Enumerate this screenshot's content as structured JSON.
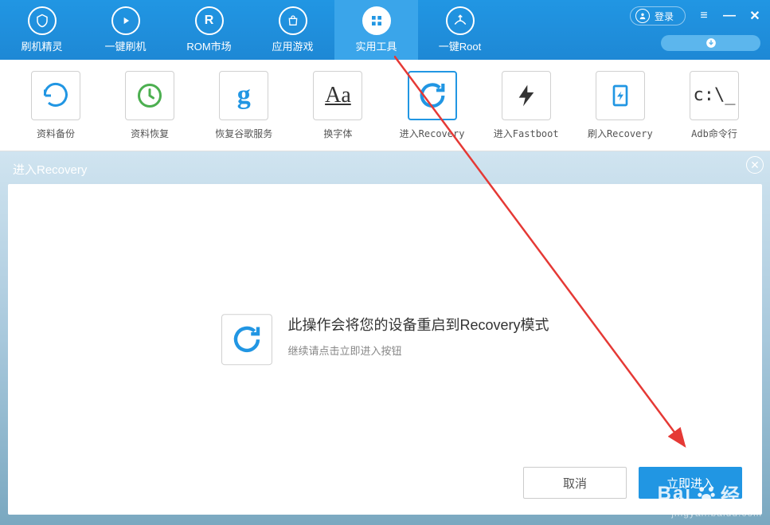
{
  "header": {
    "nav": [
      {
        "label": "刷机精灵",
        "icon": "shield"
      },
      {
        "label": "一键刷机",
        "icon": "play"
      },
      {
        "label": "ROM市场",
        "icon": "rom"
      },
      {
        "label": "应用游戏",
        "icon": "bag"
      },
      {
        "label": "实用工具",
        "icon": "grid"
      },
      {
        "label": "一键Root",
        "icon": "root"
      }
    ],
    "active_index": 4,
    "login_label": "登录"
  },
  "tools": {
    "items": [
      {
        "label": "资料备份",
        "icon": "backup"
      },
      {
        "label": "资料恢复",
        "icon": "restore"
      },
      {
        "label": "恢复谷歌服务",
        "icon": "google"
      },
      {
        "label": "换字体",
        "icon": "font"
      },
      {
        "label": "进入Recovery",
        "icon": "recovery"
      },
      {
        "label": "进入Fastboot",
        "icon": "fastboot"
      },
      {
        "label": "刷入Recovery",
        "icon": "flash"
      },
      {
        "label": "Adb命令行",
        "icon": "adb"
      }
    ],
    "selected_index": 4
  },
  "panel": {
    "title": "进入Recovery",
    "heading": "此操作会将您的设备重启到Recovery模式",
    "subtext": "继续请点击立即进入按钮",
    "cancel_label": "取消",
    "confirm_label": "立即进入"
  },
  "watermark": {
    "brand_prefix": "Bai",
    "brand_suffix": "经验",
    "url": "jingyan.baidu.com"
  },
  "icon_glyphs": {
    "google_g": "g",
    "font_aa": "Aa",
    "adb_text": "c:\\_"
  }
}
